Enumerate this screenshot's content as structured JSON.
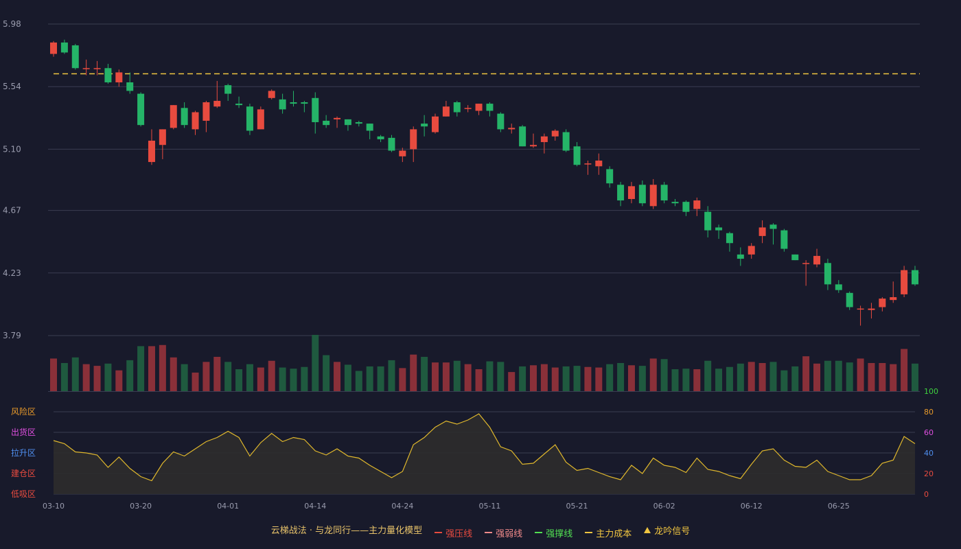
{
  "colors": {
    "background": "#181a2b",
    "grid": "#3a3d52",
    "axis_text": "#9a9cae",
    "up": "#e84b3f",
    "down": "#25b468",
    "vol_up": "#8a3039",
    "vol_down": "#1f5a3f",
    "cost_line": "#f0c541",
    "indicator_line": "#e0b82c",
    "indicator_fill": "#2e2c2c"
  },
  "legend": [
    {
      "label": "云梯战法 · 与龙同行——主力量化模型",
      "color": "#e8c36a",
      "mark": "none"
    },
    {
      "label": "强压线",
      "color": "#e84b3f",
      "mark": "solid"
    },
    {
      "label": "强弱线",
      "color": "#f08a8a",
      "mark": "dashed"
    },
    {
      "label": "强撑线",
      "color": "#52e052",
      "mark": "solid"
    },
    {
      "label": "主力成本",
      "color": "#f0c541",
      "mark": "dashed"
    },
    {
      "label": "龙吟信号",
      "color": "#f0c541",
      "mark": "triangle"
    }
  ],
  "chart_data": {
    "type": "candlestick",
    "x_ticks": [
      {
        "i": 0,
        "label": "03-10"
      },
      {
        "i": 8,
        "label": "03-20"
      },
      {
        "i": 16,
        "label": "04-01"
      },
      {
        "i": 24,
        "label": "04-14"
      },
      {
        "i": 32,
        "label": "04-24"
      },
      {
        "i": 40,
        "label": "05-11"
      },
      {
        "i": 48,
        "label": "05-21"
      },
      {
        "i": 56,
        "label": "06-02"
      },
      {
        "i": 64,
        "label": "06-12"
      },
      {
        "i": 72,
        "label": "06-25"
      }
    ],
    "price_axis": {
      "ticks": [
        "5.98",
        "5.54",
        "5.10",
        "4.67",
        "4.23",
        "3.79"
      ],
      "range": [
        3.79,
        5.98
      ]
    },
    "main_cost": 5.63,
    "candles": [
      [
        5.77,
        5.85,
        5.86,
        5.75
      ],
      [
        5.85,
        5.78,
        5.87,
        5.77
      ],
      [
        5.83,
        5.67,
        5.84,
        5.66
      ],
      [
        5.67,
        5.67,
        5.73,
        5.62
      ],
      [
        5.67,
        5.67,
        5.72,
        5.62
      ],
      [
        5.67,
        5.57,
        5.7,
        5.56
      ],
      [
        5.57,
        5.64,
        5.66,
        5.54
      ],
      [
        5.57,
        5.51,
        5.64,
        5.49
      ],
      [
        5.49,
        5.27,
        5.5,
        5.26
      ],
      [
        5.01,
        5.16,
        5.24,
        4.99
      ],
      [
        5.13,
        5.24,
        5.24,
        5.03
      ],
      [
        5.25,
        5.41,
        5.41,
        5.24
      ],
      [
        5.39,
        5.27,
        5.43,
        5.25
      ],
      [
        5.24,
        5.36,
        5.37,
        5.2
      ],
      [
        5.3,
        5.43,
        5.44,
        5.22
      ],
      [
        5.4,
        5.44,
        5.58,
        5.39
      ],
      [
        5.55,
        5.49,
        5.56,
        5.44
      ],
      [
        5.42,
        5.41,
        5.47,
        5.39
      ],
      [
        5.4,
        5.23,
        5.42,
        5.2
      ],
      [
        5.24,
        5.38,
        5.4,
        5.24
      ],
      [
        5.46,
        5.51,
        5.52,
        5.45
      ],
      [
        5.45,
        5.38,
        5.49,
        5.35
      ],
      [
        5.43,
        5.42,
        5.51,
        5.4
      ],
      [
        5.43,
        5.42,
        5.44,
        5.36
      ],
      [
        5.46,
        5.29,
        5.5,
        5.21
      ],
      [
        5.3,
        5.27,
        5.34,
        5.25
      ],
      [
        5.31,
        5.32,
        5.33,
        5.25
      ],
      [
        5.31,
        5.27,
        5.31,
        5.23
      ],
      [
        5.29,
        5.28,
        5.3,
        5.26
      ],
      [
        5.28,
        5.23,
        5.28,
        5.17
      ],
      [
        5.19,
        5.17,
        5.2,
        5.15
      ],
      [
        5.18,
        5.09,
        5.2,
        5.08
      ],
      [
        5.05,
        5.09,
        5.11,
        5.01
      ],
      [
        5.1,
        5.24,
        5.26,
        5.01
      ],
      [
        5.28,
        5.26,
        5.34,
        5.19
      ],
      [
        5.22,
        5.33,
        5.35,
        5.21
      ],
      [
        5.33,
        5.4,
        5.44,
        5.33
      ],
      [
        5.43,
        5.36,
        5.44,
        5.33
      ],
      [
        5.39,
        5.39,
        5.41,
        5.36
      ],
      [
        5.37,
        5.42,
        5.42,
        5.34
      ],
      [
        5.42,
        5.37,
        5.43,
        5.33
      ],
      [
        5.35,
        5.24,
        5.36,
        5.22
      ],
      [
        5.24,
        5.25,
        5.28,
        5.21
      ],
      [
        5.26,
        5.12,
        5.27,
        5.12
      ],
      [
        5.12,
        5.13,
        5.21,
        5.11
      ],
      [
        5.15,
        5.19,
        5.21,
        5.07
      ],
      [
        5.19,
        5.23,
        5.24,
        5.16
      ],
      [
        5.22,
        5.09,
        5.24,
        5.08
      ],
      [
        5.12,
        4.99,
        5.15,
        4.98
      ],
      [
        5.0,
        5.0,
        5.02,
        4.92
      ],
      [
        4.98,
        5.02,
        5.07,
        4.92
      ],
      [
        4.96,
        4.86,
        4.98,
        4.83
      ],
      [
        4.85,
        4.74,
        4.87,
        4.7
      ],
      [
        4.75,
        4.84,
        4.87,
        4.72
      ],
      [
        4.85,
        4.72,
        4.88,
        4.7
      ],
      [
        4.7,
        4.85,
        4.89,
        4.68
      ],
      [
        4.85,
        4.74,
        4.87,
        4.72
      ],
      [
        4.73,
        4.72,
        4.75,
        4.7
      ],
      [
        4.73,
        4.66,
        4.74,
        4.63
      ],
      [
        4.68,
        4.74,
        4.76,
        4.63
      ],
      [
        4.66,
        4.53,
        4.7,
        4.48
      ],
      [
        4.55,
        4.53,
        4.57,
        4.47
      ],
      [
        4.51,
        4.44,
        4.52,
        4.38
      ],
      [
        4.36,
        4.33,
        4.41,
        4.28
      ],
      [
        4.36,
        4.42,
        4.44,
        4.33
      ],
      [
        4.49,
        4.55,
        4.6,
        4.44
      ],
      [
        4.57,
        4.54,
        4.58,
        4.43
      ],
      [
        4.53,
        4.4,
        4.54,
        4.38
      ],
      [
        4.36,
        4.32,
        4.36,
        4.32
      ],
      [
        4.3,
        4.3,
        4.32,
        4.14
      ],
      [
        4.29,
        4.35,
        4.4,
        4.27
      ],
      [
        4.3,
        4.15,
        4.33,
        4.11
      ],
      [
        4.15,
        4.11,
        4.18,
        4.09
      ],
      [
        4.09,
        3.99,
        4.1,
        3.97
      ],
      [
        3.98,
        3.98,
        4.0,
        3.86
      ],
      [
        3.97,
        3.98,
        4.02,
        3.91
      ],
      [
        3.99,
        4.05,
        4.06,
        3.96
      ],
      [
        4.04,
        4.06,
        4.17,
        4.02
      ],
      [
        4.08,
        4.25,
        4.28,
        4.06
      ],
      [
        4.25,
        4.15,
        4.28,
        4.14
      ]
    ],
    "volumes": [
      58,
      50,
      60,
      48,
      45,
      49,
      37,
      55,
      80,
      80,
      82,
      60,
      48,
      33,
      52,
      61,
      52,
      39,
      48,
      42,
      54,
      42,
      40,
      43,
      100,
      64,
      52,
      47,
      36,
      44,
      44,
      55,
      41,
      65,
      61,
      51,
      51,
      54,
      48,
      39,
      53,
      52,
      34,
      44,
      46,
      48,
      42,
      44,
      45,
      43,
      42,
      48,
      50,
      46,
      45,
      58,
      57,
      39,
      40,
      39,
      54,
      40,
      43,
      49,
      52,
      50,
      52,
      37,
      44,
      62,
      49,
      54,
      54,
      51,
      58,
      50,
      50,
      48,
      75,
      49
    ],
    "indicator": {
      "axis_right": [
        "100",
        "80",
        "60",
        "40",
        "20",
        "0"
      ],
      "axis_right_colors": [
        "#3fd13f",
        "#e89a2a",
        "#e04fe0",
        "#4f8ff0",
        "#e84b3f",
        "#e84b3f"
      ],
      "zones": [
        "风险区",
        "出货区",
        "拉升区",
        "建仓区",
        "低吸区"
      ],
      "zone_colors": [
        "#e89a2a",
        "#e04fe0",
        "#4f8ff0",
        "#e84b3f",
        "#e84b3f"
      ],
      "range": [
        0,
        100
      ],
      "values": [
        52,
        49,
        41,
        40,
        38,
        26,
        36,
        25,
        17,
        13,
        30,
        41,
        37,
        44,
        51,
        55,
        61,
        55,
        37,
        50,
        59,
        51,
        55,
        53,
        42,
        38,
        44,
        37,
        35,
        28,
        22,
        16,
        22,
        48,
        55,
        65,
        71,
        68,
        72,
        78,
        65,
        46,
        42,
        29,
        30,
        39,
        48,
        31,
        23,
        25,
        21,
        17,
        14,
        28,
        20,
        35,
        28,
        26,
        21,
        35,
        24,
        22,
        18,
        15,
        29,
        42,
        44,
        33,
        27,
        26,
        33,
        22,
        18,
        14,
        14,
        18,
        30,
        33,
        56,
        49
      ]
    }
  }
}
